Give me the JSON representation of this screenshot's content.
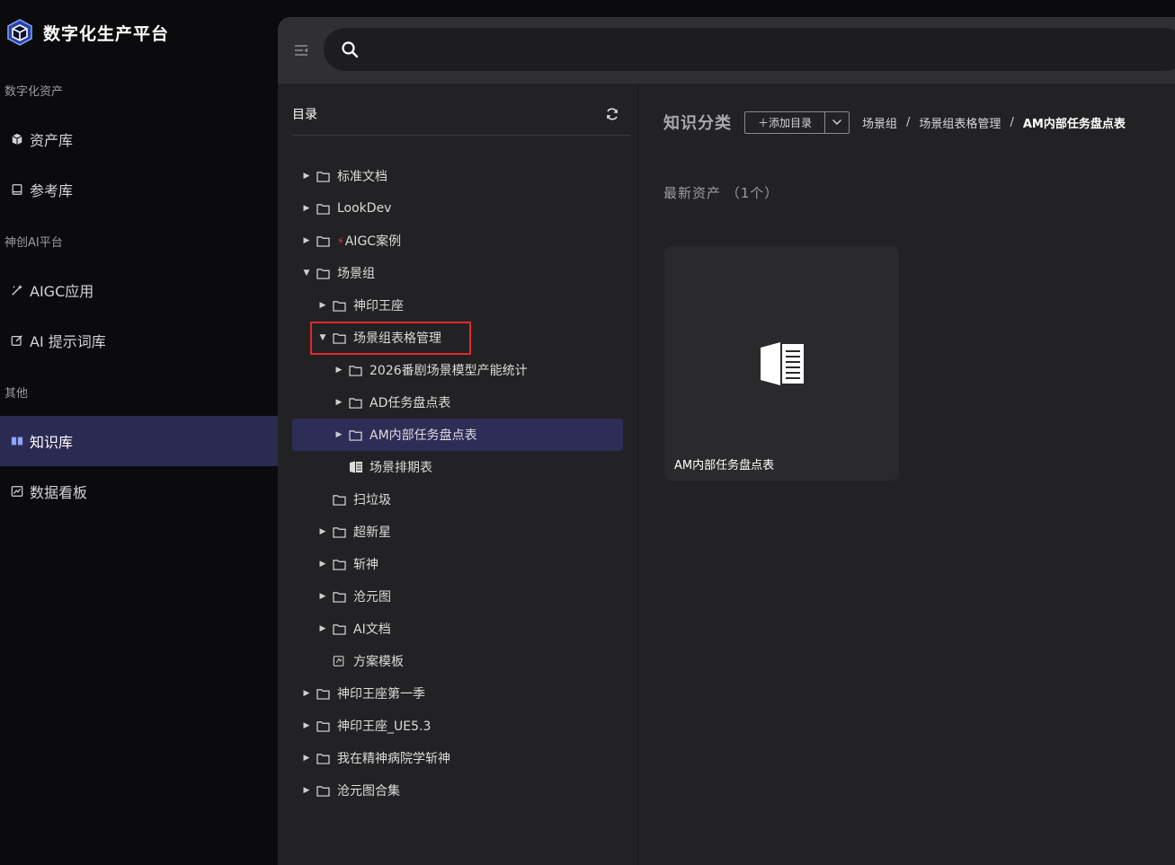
{
  "brand": {
    "title": "数字化生产平台"
  },
  "sidebar": {
    "sections": [
      {
        "label": "数字化资产",
        "items": [
          {
            "label": "资产库",
            "icon": "cube-icon"
          },
          {
            "label": "参考库",
            "icon": "book-icon"
          }
        ]
      },
      {
        "label": "神创AI平台",
        "items": [
          {
            "label": "AIGC应用",
            "icon": "magic-wand-icon"
          },
          {
            "label": "AI 提示词库",
            "icon": "edit-icon"
          }
        ]
      },
      {
        "label": "其他",
        "items": [
          {
            "label": "知识库",
            "icon": "open-book-icon",
            "active": true
          },
          {
            "label": "数据看板",
            "icon": "chart-icon"
          }
        ]
      }
    ]
  },
  "search": {
    "placeholder": ""
  },
  "tree": {
    "title": "目录",
    "nodes": [
      {
        "label": "标准文档",
        "level": 0,
        "type": "folder",
        "expand": "collapsed"
      },
      {
        "label": "LookDev",
        "level": 0,
        "type": "folder",
        "expand": "collapsed"
      },
      {
        "label": "AIGC案例",
        "level": 0,
        "type": "folder",
        "expand": "collapsed",
        "emoji": "⚡"
      },
      {
        "label": "场景组",
        "level": 0,
        "type": "folder",
        "expand": "expanded"
      },
      {
        "label": "神印王座",
        "level": 1,
        "type": "folder",
        "expand": "collapsed"
      },
      {
        "label": "场景组表格管理",
        "level": 1,
        "type": "folder",
        "expand": "expanded",
        "highlighted": true
      },
      {
        "label": "2026番剧场景模型产能统计",
        "level": 2,
        "type": "folder",
        "expand": "collapsed"
      },
      {
        "label": "AD任务盘点表",
        "level": 2,
        "type": "folder",
        "expand": "collapsed"
      },
      {
        "label": "AM内部任务盘点表",
        "level": 2,
        "type": "folder",
        "expand": "collapsed",
        "selected": true
      },
      {
        "label": "场景排期表",
        "level": 2,
        "type": "doc",
        "expand": "none"
      },
      {
        "label": "扫垃圾",
        "level": 1,
        "type": "folder",
        "expand": "none"
      },
      {
        "label": "超新星",
        "level": 1,
        "type": "folder",
        "expand": "collapsed"
      },
      {
        "label": "斩神",
        "level": 1,
        "type": "folder",
        "expand": "collapsed"
      },
      {
        "label": "沧元图",
        "level": 1,
        "type": "folder",
        "expand": "collapsed"
      },
      {
        "label": "AI文档",
        "level": 1,
        "type": "folder",
        "expand": "collapsed"
      },
      {
        "label": "方案模板",
        "level": 1,
        "type": "template",
        "expand": "none"
      },
      {
        "label": "神印王座第一季",
        "level": 0,
        "type": "folder",
        "expand": "collapsed"
      },
      {
        "label": "神印王座_UE5.3",
        "level": 0,
        "type": "folder",
        "expand": "collapsed"
      },
      {
        "label": "我在精神病院学斩神",
        "level": 0,
        "type": "folder",
        "expand": "collapsed"
      },
      {
        "label": "沧元图合集",
        "level": 0,
        "type": "folder",
        "expand": "collapsed"
      }
    ]
  },
  "content": {
    "title": "知识分类",
    "add_dir_label": "＋添加目录",
    "breadcrumb": [
      "场景组",
      "场景组表格管理",
      "AM内部任务盘点表"
    ],
    "breadcrumb_sep": "/",
    "latest_label": "最新资产 （1个）",
    "assets": [
      {
        "name": "AM内部任务盘点表",
        "icon": "document-icon"
      }
    ]
  },
  "colors": {
    "accent": "#2b2a52",
    "highlight": "#e12a2a",
    "panel": "#222224",
    "topbar": "#303033"
  }
}
